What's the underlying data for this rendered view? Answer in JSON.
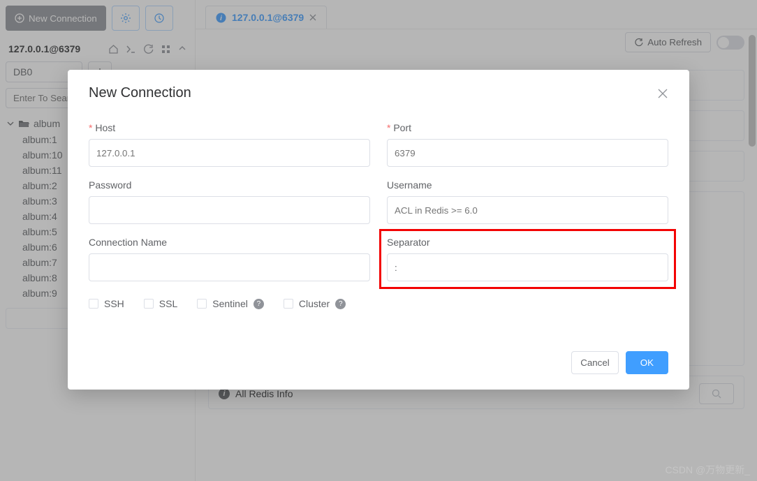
{
  "sidebar": {
    "new_connection_label": "New Connection",
    "connection_title": "127.0.0.1@6379",
    "db_selected": "DB0",
    "search_placeholder": "Enter To Search",
    "tree_root": "album",
    "tree_items": [
      "album:1",
      "album:10",
      "album:11",
      "album:2",
      "album:3",
      "album:4",
      "album:5",
      "album:6",
      "album:7",
      "album:8",
      "album:9"
    ]
  },
  "tabs": {
    "active_label": "127.0.0.1@6379"
  },
  "main": {
    "auto_refresh_label": "Auto Refresh",
    "all_redis_info_label": "All Redis Info"
  },
  "dialog": {
    "title": "New Connection",
    "host_label": "Host",
    "host_placeholder": "127.0.0.1",
    "port_label": "Port",
    "port_placeholder": "6379",
    "password_label": "Password",
    "username_label": "Username",
    "username_placeholder": "ACL in Redis >= 6.0",
    "connection_name_label": "Connection Name",
    "separator_label": "Separator",
    "separator_value": ":",
    "ssh_label": "SSH",
    "ssl_label": "SSL",
    "sentinel_label": "Sentinel",
    "cluster_label": "Cluster",
    "cancel_label": "Cancel",
    "ok_label": "OK"
  },
  "watermark": "CSDN @万物更新_"
}
